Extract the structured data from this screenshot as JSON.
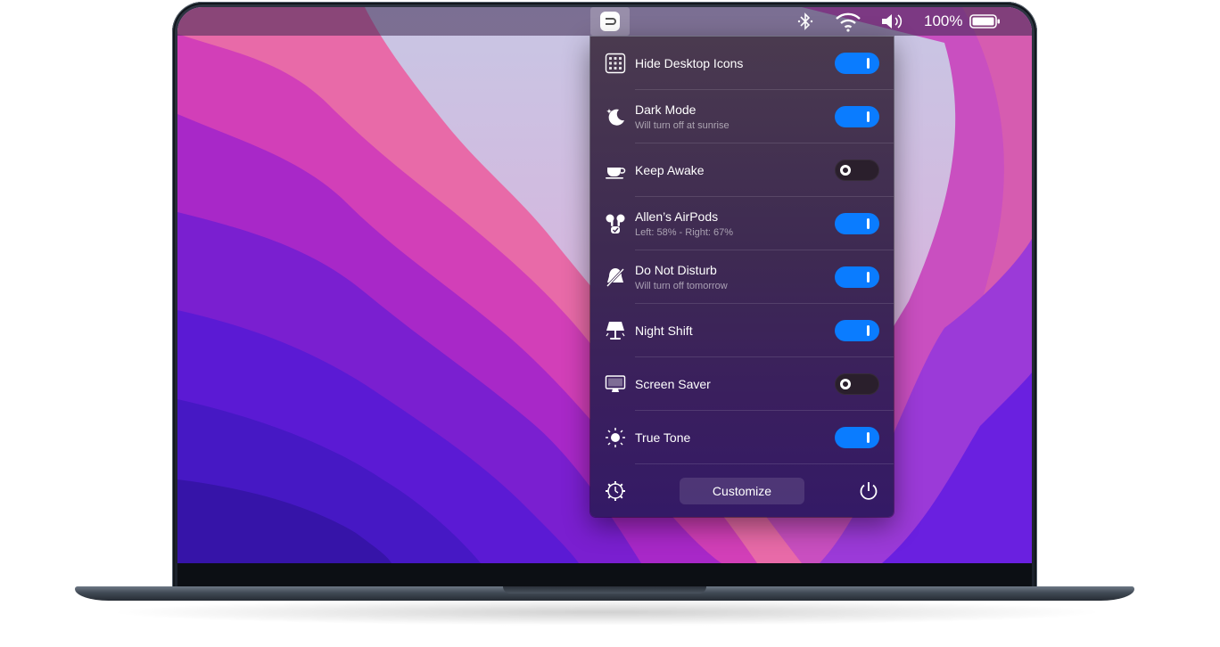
{
  "menubar": {
    "app_icon": "shortcut-app-icon",
    "status_icons": [
      "bluetooth-icon",
      "wifi-icon",
      "volume-icon",
      "battery-icon"
    ],
    "battery_percent": "100%"
  },
  "menu": {
    "items": [
      {
        "title": "Hide Desktop Icons",
        "subtitle": "",
        "icon": "grid-icon",
        "enabled": true
      },
      {
        "title": "Dark Mode",
        "subtitle": "Will turn off at sunrise",
        "icon": "moon-icon",
        "enabled": true
      },
      {
        "title": "Keep Awake",
        "subtitle": "",
        "icon": "coffee-cup-icon",
        "enabled": false
      },
      {
        "title": "Allen’s AirPods",
        "subtitle": "Left: 58% - Right: 67%",
        "icon": "airpods-icon",
        "enabled": true
      },
      {
        "title": "Do Not Disturb",
        "subtitle": "Will turn off tomorrow",
        "icon": "bell-slash-icon",
        "enabled": true
      },
      {
        "title": "Night Shift",
        "subtitle": "",
        "icon": "lamp-icon",
        "enabled": true
      },
      {
        "title": "Screen Saver",
        "subtitle": "",
        "icon": "monitor-icon",
        "enabled": false
      },
      {
        "title": "True Tone",
        "subtitle": "",
        "icon": "sun-icon",
        "enabled": true
      }
    ],
    "footer": {
      "customize_label": "Customize",
      "settings_icon": "gear-icon",
      "quit_icon": "power-icon"
    }
  },
  "colors": {
    "toggle_on": "#0a7cff",
    "toggle_off": "#2a1f2c",
    "panel_top": "#4a3a4f",
    "panel_bottom": "#341a66"
  }
}
